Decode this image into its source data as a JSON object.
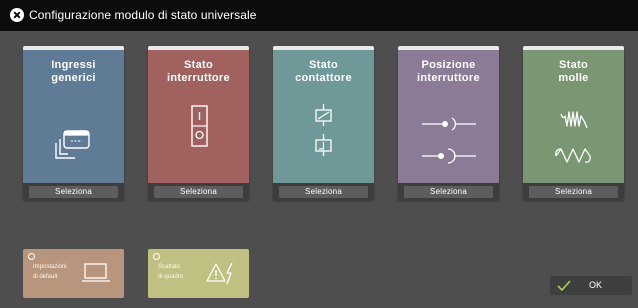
{
  "window": {
    "title": "Configurazione modulo di stato universale"
  },
  "cards": [
    {
      "title_line1": "Ingressi",
      "title_line2": "generici",
      "button": "Seleziona",
      "icon": "input-window-icon",
      "color": "#5f7b96"
    },
    {
      "title_line1": "Stato",
      "title_line2": "interruttore",
      "button": "Seleziona",
      "icon": "breaker-icon",
      "color": "#a1615f"
    },
    {
      "title_line1": "Stato",
      "title_line2": "contattore",
      "button": "Seleziona",
      "icon": "contactor-coil-icon",
      "color": "#6f9998"
    },
    {
      "title_line1": "Posizione",
      "title_line2": "interruttore",
      "button": "Seleziona",
      "icon": "switch-position-icon",
      "color": "#8c7b97"
    },
    {
      "title_line1": "Stato",
      "title_line2": "molle",
      "button": "Seleziona",
      "icon": "spring-icon",
      "color": "#7b9673"
    }
  ],
  "tiles": [
    {
      "line1": "Impostazioni",
      "line2": "di default",
      "icon": "laptop-icon",
      "color": "#b8957d"
    },
    {
      "line1": "Scattato",
      "line2": "di quadro",
      "icon": "warning-lightning-icon",
      "color": "#c0c083"
    }
  ],
  "ok_button": {
    "label": "OK",
    "icon": "checkmark-icon",
    "check_color": "#a8d44e"
  }
}
